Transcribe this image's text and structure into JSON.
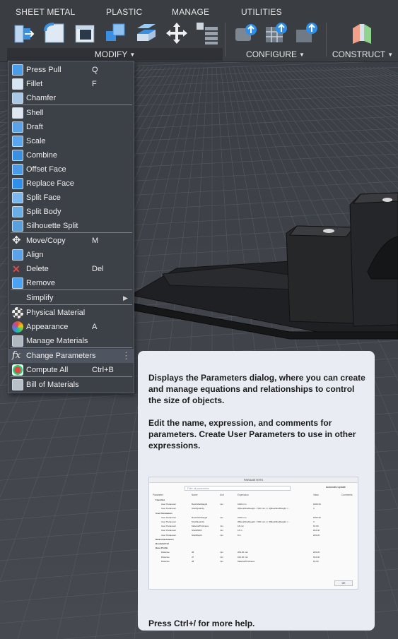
{
  "tabs": [
    "SHEET METAL",
    "PLASTIC",
    "MANAGE",
    "UTILITIES"
  ],
  "groups": {
    "modify": "MODIFY",
    "configure": "CONFIGURE",
    "construct": "CONSTRUCT"
  },
  "menu": {
    "items": [
      {
        "label": "Press Pull",
        "shortcut": "Q",
        "icon": "press-pull-icon"
      },
      {
        "label": "Fillet",
        "shortcut": "F",
        "icon": "fillet-icon"
      },
      {
        "label": "Chamfer",
        "shortcut": "",
        "icon": "chamfer-icon"
      },
      {
        "label": "Shell",
        "shortcut": "",
        "icon": "shell-icon"
      },
      {
        "label": "Draft",
        "shortcut": "",
        "icon": "draft-icon"
      },
      {
        "label": "Scale",
        "shortcut": "",
        "icon": "scale-icon"
      },
      {
        "label": "Combine",
        "shortcut": "",
        "icon": "combine-icon"
      },
      {
        "label": "Offset Face",
        "shortcut": "",
        "icon": "offset-face-icon"
      },
      {
        "label": "Replace Face",
        "shortcut": "",
        "icon": "replace-face-icon"
      },
      {
        "label": "Split Face",
        "shortcut": "",
        "icon": "split-face-icon"
      },
      {
        "label": "Split Body",
        "shortcut": "",
        "icon": "split-body-icon"
      },
      {
        "label": "Silhouette Split",
        "shortcut": "",
        "icon": "silhouette-split-icon"
      },
      {
        "label": "Move/Copy",
        "shortcut": "M",
        "icon": "move-icon"
      },
      {
        "label": "Align",
        "shortcut": "",
        "icon": "align-icon"
      },
      {
        "label": "Delete",
        "shortcut": "Del",
        "icon": "delete-icon"
      },
      {
        "label": "Remove",
        "shortcut": "",
        "icon": "remove-icon"
      },
      {
        "label": "Simplify",
        "shortcut": "",
        "icon": ""
      },
      {
        "label": "Physical Material",
        "shortcut": "",
        "icon": "physical-material-icon"
      },
      {
        "label": "Appearance",
        "shortcut": "A",
        "icon": "appearance-icon"
      },
      {
        "label": "Manage Materials",
        "shortcut": "",
        "icon": "manage-materials-icon"
      },
      {
        "label": "Change Parameters",
        "shortcut": "",
        "icon": "fx-icon"
      },
      {
        "label": "Compute All",
        "shortcut": "Ctrl+B",
        "icon": "compute-all-icon"
      },
      {
        "label": "Bill of Materials",
        "shortcut": "",
        "icon": "bill-of-materials-icon"
      }
    ]
  },
  "tooltip": {
    "para1": "Displays the Parameters dialog, where you can create and manage equations and relationships to control the size of objects.",
    "para2": "Edit the name, expression, and comments for parameters. Create User Parameters to use in other expressions.",
    "help": "Press Ctrl+/ for more help.",
    "dialog": {
      "title": "PARAMETERS",
      "search_placeholder": "Filter all parameters",
      "auto_update": "Automatic Update",
      "columns": [
        "Parameter",
        "Name",
        "Unit",
        "Expression",
        "Value",
        "Comments"
      ],
      "rows": [
        [
          "Favorites",
          "",
          "",
          "",
          "",
          ""
        ],
        [
          "User Parameter",
          "BookShelfHeight",
          "mm",
          "1000 mm",
          "1800.00",
          ""
        ],
        [
          "User Parameter",
          "ShelfQuantity",
          "",
          "if(BookShelfHeight < 500 mm; 2; if(BookShelfHeight <...",
          "3",
          ""
        ],
        [
          "User Parameters",
          "",
          "",
          "",
          "",
          ""
        ],
        [
          "User Parameter",
          "BookShelfHeight",
          "mm",
          "1000 mm",
          "1800.00",
          ""
        ],
        [
          "User Parameter",
          "ShelfQuantity",
          "",
          "if(BookShelfHeight < 500 mm; 2; if(BookShelfHeight <...",
          "3",
          ""
        ],
        [
          "User Parameter",
          "MaterialThickness",
          "mm",
          "18 mm",
          "18.00",
          ""
        ],
        [
          "User Parameter",
          "ShelfWidth",
          "mm",
          "16 in",
          "914.40",
          ""
        ],
        [
          "User Parameter",
          "ShelfDepth",
          "mm",
          "8 in",
          "203.20",
          ""
        ],
        [
          "Model Parameters",
          "",
          "",
          "",
          "",
          ""
        ],
        [
          "Bookshelf v9",
          "",
          "",
          "",
          "",
          ""
        ],
        [
          "Base Profile",
          "",
          "",
          "",
          "",
          ""
        ],
        [
          "Distance",
          "d6",
          "mm",
          "203.20 mm",
          "203.20",
          ""
        ],
        [
          "Distance",
          "d7",
          "mm",
          "914.40 mm",
          "914.40",
          ""
        ],
        [
          "Distance",
          "d8",
          "mm",
          "MaterialThickness",
          "18.00",
          ""
        ]
      ],
      "ok": "OK"
    }
  }
}
